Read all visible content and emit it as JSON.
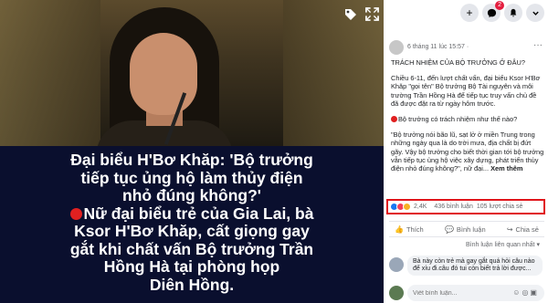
{
  "caption": {
    "line1": "Đại biểu H'Bơ Khăp: 'Bộ trưởng",
    "line2": "tiếp tục ủng hộ làm thủy điện",
    "line3": "nhỏ đúng không?'",
    "line4": "Nữ đại biểu trẻ của Gia Lai, bà",
    "line5": "Ksor H'Bơ Khăp, cất giọng gay",
    "line6": "gắt khi chất vấn Bộ trưởng Trần",
    "line7": "Hồng Hà tại phòng họp",
    "line8": "Diên Hồng."
  },
  "topbar": {
    "plus": "+",
    "notif_count": "2"
  },
  "post": {
    "time": "6 tháng 11 lúc 15:57 · ",
    "title": "TRÁCH NHIỆM CỦA BỘ TRƯỞNG Ở ĐÂU?",
    "para1": "Chiều 6-11, đến lượt chất vấn, đại biểu Ksor H'Bơ Khăp \"gọi tên\" Bộ trưởng Bộ Tài nguyên và môi trường Trần Hồng Hà để tiếp tục truy vấn chủ đề đã được đặt ra từ ngày hôm trước.",
    "para2": "Bộ trưởng có trách nhiệm như thế nào?",
    "para3": "\"Bộ trưởng nói bão lũ, sạt lở ở miền Trung trong những ngày qua là do trời mưa, địa chất bị đứt gãy. Vậy bộ trưởng cho biết thời gian tới bộ trưởng vẫn tiếp tục ủng hộ việc xây dựng, phát triển thủy điện nhỏ đúng không?\", nữ đại...",
    "more": "Xem thêm"
  },
  "reactions": {
    "count": "2,4K",
    "comments": "436 bình luận",
    "shares": "105 lượt chia sẻ"
  },
  "actions": {
    "like": "Thích",
    "comment": "Bình luận",
    "share": "Chia sẻ"
  },
  "sort_label": "Bình luận liên quan nhất ▾",
  "comment": {
    "text": "Bà này còn trẻ mà gay gắt quá hỏi câu nào để xíu đi.câu đó tui còn biết trả lời được..."
  },
  "write": {
    "placeholder": "Viết bình luận..."
  }
}
